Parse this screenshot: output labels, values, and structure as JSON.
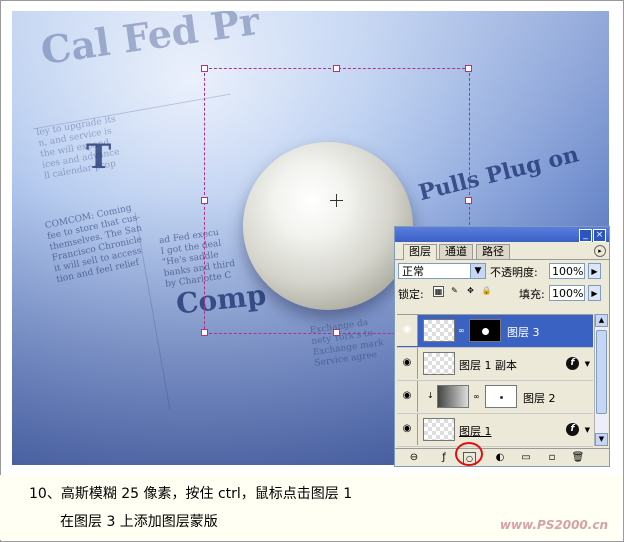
{
  "panel": {
    "tabs": [
      "图层",
      "通道",
      "路径"
    ],
    "blend_mode": "正常",
    "opacity_label": "不透明度:",
    "opacity_value": "100%",
    "lock_label": "锁定:",
    "fill_label": "填充:",
    "fill_value": "100%",
    "layers": [
      {
        "name": "图层 3",
        "selected": true
      },
      {
        "name": "图层 1 副本",
        "selected": false
      },
      {
        "name": "图层 2",
        "selected": false
      },
      {
        "name": "图层 1",
        "selected": false
      }
    ]
  },
  "canvas": {
    "headline_right": "Pulls Plug on",
    "headline_left": "Comp",
    "letter_t": "T"
  },
  "caption": {
    "line1": "10、高斯模糊 25 像素，按住 ctrl，鼠标点击图层 1",
    "line2": "在图层 3 上添加图层蒙版",
    "watermark": "www.PS2000.cn"
  },
  "colors": {
    "selection": "#b0308a",
    "highlight_circle": "#e01010",
    "selected_layer": "#3a62c3"
  }
}
